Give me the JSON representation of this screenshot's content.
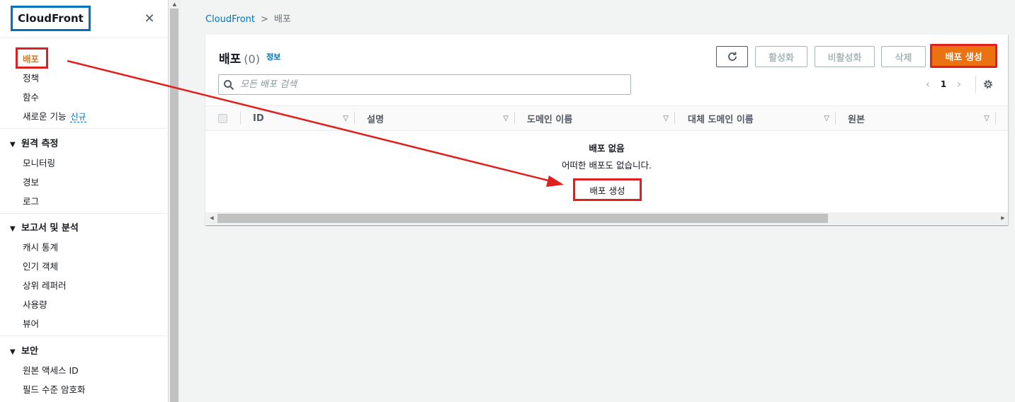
{
  "sidebar": {
    "brand": "CloudFront",
    "close_icon": "close-icon",
    "items": [
      {
        "label": "배포",
        "active": true
      },
      {
        "label": "정책"
      },
      {
        "label": "함수"
      },
      {
        "label": "새로운 기능",
        "badge": "신규"
      }
    ],
    "sections": [
      {
        "title": "원격 측정",
        "items": [
          "모니터링",
          "경보",
          "로그"
        ]
      },
      {
        "title": "보고서 및 분석",
        "items": [
          "캐시 통계",
          "인기 객체",
          "상위 레퍼러",
          "사용량",
          "뷰어"
        ]
      },
      {
        "title": "보안",
        "items": [
          "원본 액세스 ID",
          "필드 수준 암호화"
        ]
      }
    ]
  },
  "breadcrumb": {
    "root": "CloudFront",
    "current": "배포"
  },
  "panel": {
    "title": "배포",
    "count": "(0)",
    "info": "정보",
    "buttons": {
      "refresh_icon": "refresh-icon",
      "activate": "활성화",
      "deactivate": "비활성화",
      "delete": "삭제",
      "create": "배포 생성"
    },
    "search": {
      "placeholder": "모든 배포 검색"
    },
    "pagination": {
      "current_page": "1"
    },
    "columns": [
      "ID",
      "설명",
      "도메인 이름",
      "대체 도메인 이름",
      "원본"
    ],
    "empty": {
      "title": "배포 없음",
      "description": "어떠한 배포도 없습니다.",
      "create_button": "배포 생성"
    }
  },
  "colors": {
    "accent": "#ec7211",
    "link": "#0073bb",
    "annotation": "#e02020",
    "brand_border": "#0073bb"
  }
}
